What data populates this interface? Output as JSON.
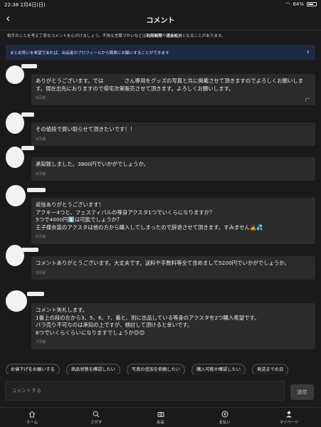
{
  "status_bar": {
    "time": "22:38",
    "date": "2月4日(日)",
    "battery": "64%"
  },
  "header": {
    "title": "コメント"
  },
  "notice": {
    "before": "相手のことを考え丁寧なコメントを心がけましょう。不快な言葉づかいなどは",
    "bold1": "利用制限",
    "mid": "や",
    "bold2": "退会処分",
    "after": "となることがあります。"
  },
  "banner": {
    "text": "まとめ買いを希望であれば、出品者のプロフィールから簡単にお願いすることができます"
  },
  "comments": [
    {
      "text": "ありがとうございます。では　　　　さん専用をグッズの写真と共に掲載させて頂きますのでよろしくお願いします。現在出先におりますので帰宅次第販売させて頂きます。よろしくお願いします。",
      "time": "5日前"
    },
    {
      "text": "その値段で買い取らせて頂きたいです！！",
      "time": "5日前"
    },
    {
      "text": "承知致しました。3800円でいかがでしょうか。",
      "time": "5日前"
    },
    {
      "text": "返信ありがとうございます！\nアクキー4つと、フェスティバルの等身アクスタ1つでいくらになりますか？\n5つで4000円⬇️は可能でしょうか？\n王子様衣装のアクスタは他の方から購入してしまったので辞退させて頂きます。すみません🙇💦",
      "time": "5日前"
    },
    {
      "text": "コメントありがとうございます。大丈夫です。送料や手数料等全て含めまして5200円でいかがでしょうか。",
      "time": "5日前"
    },
    {
      "text": "コメント失礼します。\n1番上の段の左から3、5、6、7、番と、別に出品している等身のアクスタを2つ購入希望です。\nバラ売り不可なのは承知の上ですが、検討して頂けると幸いです。\n6つでいくらくらいになりますでしょうか😊😊",
      "time": "7日前"
    }
  ],
  "chips": [
    "お値下げをお願いする",
    "商品状態を確認したい",
    "写真の追加を依頼したい",
    "購入可能か確認したい",
    "発送までの日"
  ],
  "composer": {
    "placeholder": "コメントする",
    "send_label": "送信"
  },
  "tabs": [
    {
      "label": "ホーム",
      "icon": "home-icon"
    },
    {
      "label": "さがす",
      "icon": "search-icon"
    },
    {
      "label": "出品",
      "icon": "camera-icon"
    },
    {
      "label": "支払い",
      "icon": "payment-icon"
    },
    {
      "label": "マイページ",
      "icon": "person-icon"
    }
  ]
}
